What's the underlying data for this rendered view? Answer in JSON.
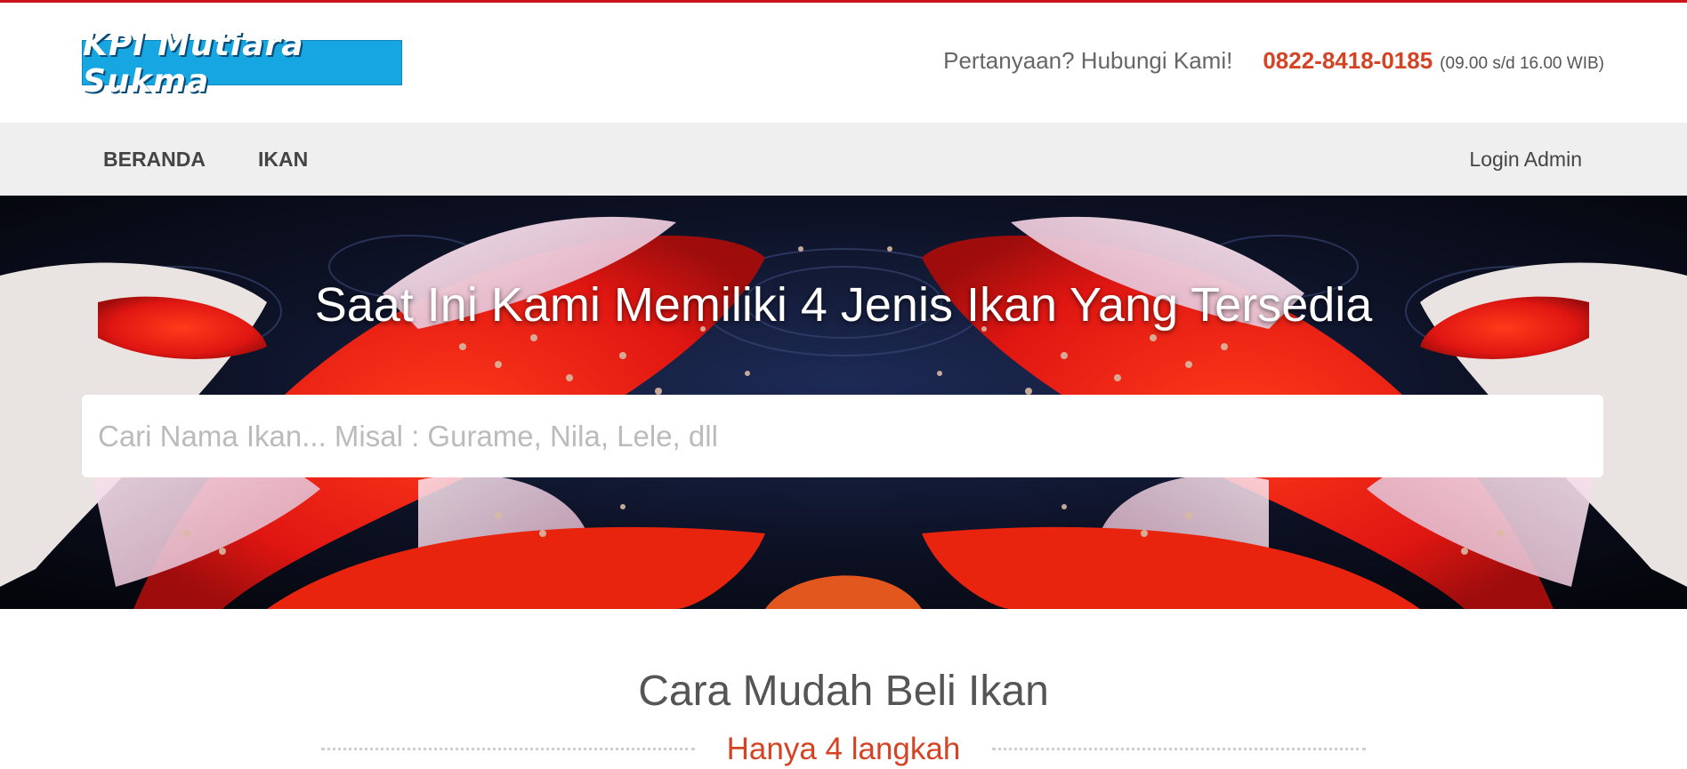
{
  "header": {
    "logo_text": "KPI Mutiara Sukma",
    "contact_question": "Pertanyaan? Hubungi Kami!",
    "phone": "0822-8418-0185",
    "hours": "(09.00 s/d 16.00 WIB)"
  },
  "nav": {
    "items": [
      {
        "label": "BERANDA"
      },
      {
        "label": "IKAN"
      }
    ],
    "login_label": "Login Admin"
  },
  "hero": {
    "title": "Saat Ini Kami Memiliki 4 Jenis Ikan Yang Tersedia",
    "search_placeholder": "Cari Nama Ikan... Misal : Gurame, Nila, Lele, dll",
    "search_value": ""
  },
  "section": {
    "title": "Cara Mudah Beli Ikan",
    "subtitle": "Hanya 4 langkah"
  },
  "colors": {
    "accent_red": "#d44424",
    "top_border": "#c8151b",
    "logo_bg": "#16a7e2",
    "nav_bg": "#efefef"
  },
  "icons": {
    "hero_background": "koi-fish-background-image"
  }
}
